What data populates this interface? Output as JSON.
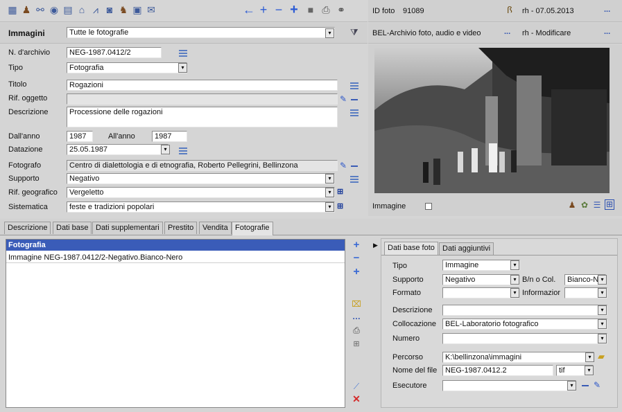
{
  "toolbar": {
    "icons": [
      "list-icon",
      "user-icon",
      "binoculars-icon",
      "eye-icon",
      "document-icon",
      "home-icon",
      "chart-icon",
      "camera-icon",
      "people-icon",
      "calendar-icon",
      "mail-icon"
    ],
    "nav_icons": [
      "arrow-left-icon",
      "plus-icon",
      "minus-icon",
      "plus-bold-icon",
      "square-icon",
      "print-icon",
      "search-binoculars-icon"
    ]
  },
  "header": {
    "module": "Immagini",
    "selection": "Tutte le fotografie",
    "id_label": "ID foto",
    "id_value": "91089",
    "created": "rh - 07.05.2013",
    "archive": "BEL-Archivio foto, audio e video",
    "modified": "rh - Modificare",
    "more": "..."
  },
  "form": {
    "n_archivio_label": "N. d'archivio",
    "n_archivio": "NEG-1987.0412/2",
    "tipo_label": "Tipo",
    "tipo": "Fotografia",
    "titolo_label": "Titolo",
    "titolo": "Rogazioni",
    "rif_oggetto_label": "Rif. oggetto",
    "rif_oggetto": "",
    "descrizione_label": "Descrizione",
    "descrizione": "Processione delle rogazioni",
    "dallanno_label": "Dall'anno",
    "dallanno": "1987",
    "allanno_label": "All'anno",
    "allanno": "1987",
    "datazione_label": "Datazione",
    "datazione": "25.05.1987",
    "fotografo_label": "Fotografo",
    "fotografo": "Centro di dialettologia e di etnografia, Roberto Pellegrini, Bellinzona",
    "supporto_label": "Supporto",
    "supporto": "Negativo",
    "rif_geografico_label": "Rif. geografico",
    "rif_geografico": "Vergeletto",
    "sistematica_label": "Sistematica",
    "sistematica": "feste e tradizioni popolari"
  },
  "image_panel": {
    "label": "Immagine"
  },
  "tabs": [
    "Descrizione",
    "Dati base",
    "Dati supplementari",
    "Prestito",
    "Vendita",
    "Fotografie"
  ],
  "list": {
    "header": "Fotografia",
    "rows": [
      "Immagine NEG-1987.0412/2-Negativo.Bianco-Nero"
    ]
  },
  "subtabs": [
    "Dati base foto",
    "Dati aggiuntivi"
  ],
  "detail": {
    "tipo_label": "Tipo",
    "tipo": "Immagine",
    "supporto_label": "Supporto",
    "supporto": "Negativo",
    "bn_label": "B/n o Col.",
    "bn": "Bianco-Ne",
    "formato_label": "Formato",
    "formato": "",
    "informazioni_label": "Informazior",
    "informazioni": "",
    "descrizione_label": "Descrizione",
    "descrizione": "",
    "collocazione_label": "Collocazione",
    "collocazione": "BEL-Laboratorio fotografico",
    "numero_label": "Numero",
    "numero": "",
    "percorso_label": "Percorso",
    "percorso": "K:\\bellinzona\\immagini",
    "nome_file_label": "Nome del file",
    "nome_file": "NEG-1987.0412.2",
    "estensione": "tif",
    "esecutore_label": "Esecutore",
    "esecutore": ""
  }
}
